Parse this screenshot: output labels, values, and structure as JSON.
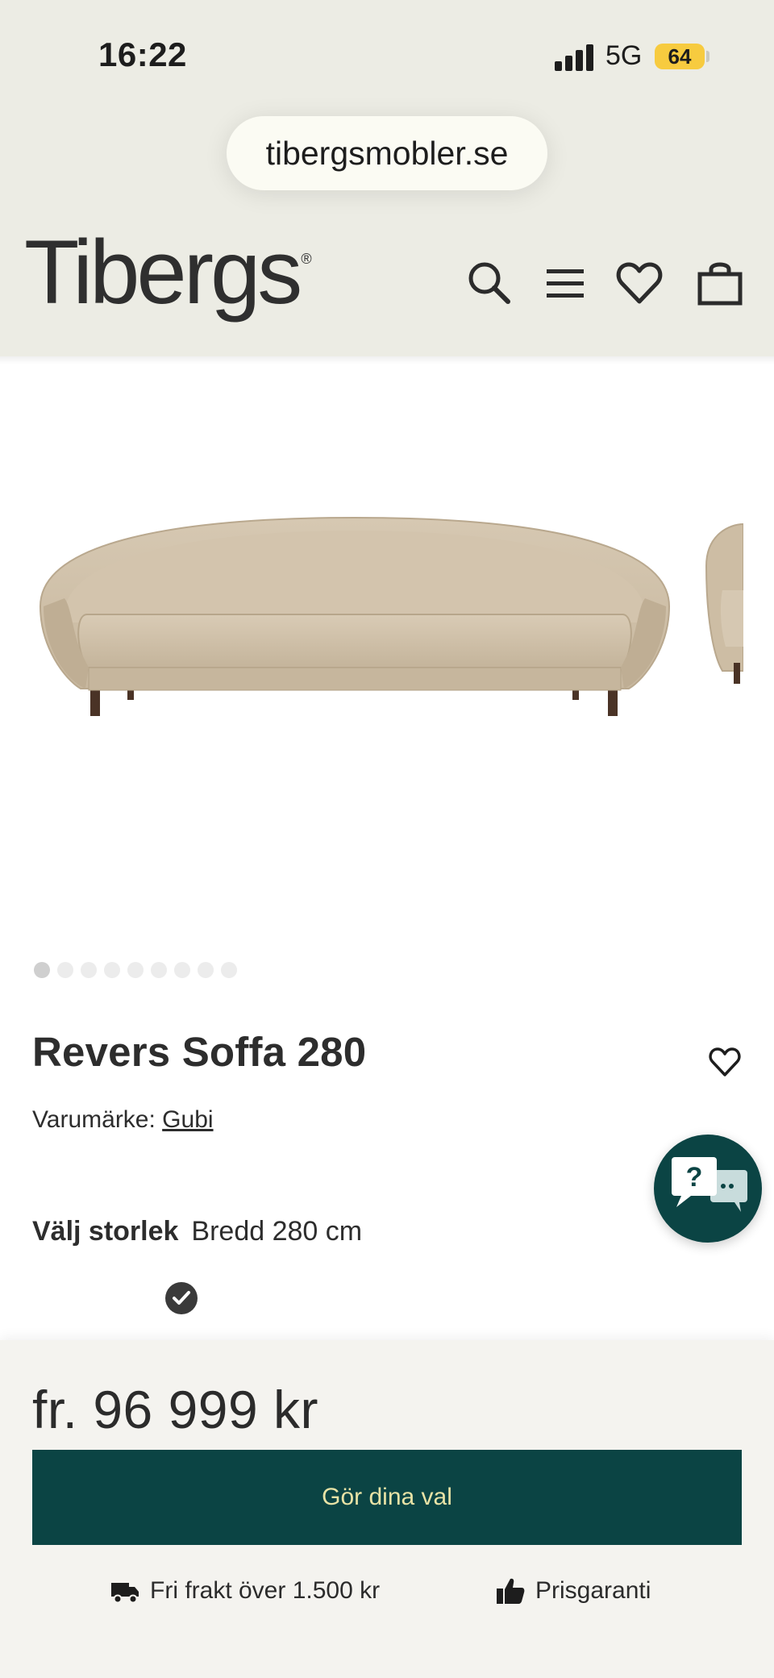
{
  "statusbar": {
    "time": "16:22",
    "network": "5G",
    "battery": "64"
  },
  "browser": {
    "url": "tibergsmobler.se"
  },
  "header": {
    "logo": "Tibergs",
    "logo_mark": "®",
    "icons": [
      "search-icon",
      "menu-icon",
      "heart-icon",
      "bag-icon"
    ]
  },
  "gallery": {
    "image_count": 9,
    "active_index": 0
  },
  "product": {
    "title": "Revers Soffa 280",
    "brand_label": "Varumärke:",
    "brand_name": "Gubi",
    "size_label": "Välj storlek",
    "size_value": "Bredd 280 cm"
  },
  "bottom_bar": {
    "price": "fr. 96 999 kr",
    "cta": "Gör dina val",
    "usp_shipping": "Fri frakt över 1.500 kr",
    "usp_price": "Prisgaranti"
  },
  "colors": {
    "header_bg": "#ecece4",
    "accent": "#0b4444",
    "cta_text": "#e8e3a6",
    "battery": "#f7cb3f"
  }
}
